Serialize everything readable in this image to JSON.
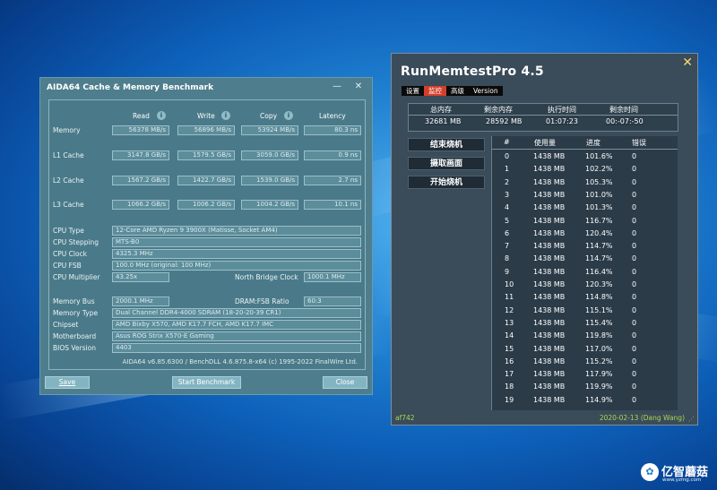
{
  "aida": {
    "title": "AIDA64 Cache & Memory Benchmark",
    "minimize": "—",
    "close": "✕",
    "columns": {
      "read": "Read",
      "write": "Write",
      "copy": "Copy",
      "latency": "Latency"
    },
    "info_glyph": "i",
    "bench_rows": [
      {
        "label": "Memory",
        "read": "56378 MB/s",
        "write": "56896 MB/s",
        "copy": "53924 MB/s",
        "latency": "80.3 ns"
      },
      {
        "label": "L1 Cache",
        "read": "3147.8 GB/s",
        "write": "1579.5 GB/s",
        "copy": "3059.0 GB/s",
        "latency": "0.9 ns"
      },
      {
        "label": "L2 Cache",
        "read": "1567.2 GB/s",
        "write": "1422.7 GB/s",
        "copy": "1539.0 GB/s",
        "latency": "2.7 ns"
      },
      {
        "label": "L3 Cache",
        "read": "1066.2 GB/s",
        "write": "1006.2 GB/s",
        "copy": "1004.2 GB/s",
        "latency": "10.1 ns"
      }
    ],
    "cpu": {
      "type_label": "CPU Type",
      "type": "12-Core AMD Ryzen 9 3900X  (Matisse, Socket AM4)",
      "stepping_label": "CPU Stepping",
      "stepping": "MTS-B0",
      "clock_label": "CPU Clock",
      "clock": "4325.3 MHz",
      "fsb_label": "CPU FSB",
      "fsb": "100.0 MHz  (original: 100 MHz)",
      "multiplier_label": "CPU Multiplier",
      "multiplier": "43.25x",
      "nb_label": "North Bridge Clock",
      "nb": "1000.1 MHz"
    },
    "mem": {
      "bus_label": "Memory Bus",
      "bus": "2000.1 MHz",
      "ratio_label": "DRAM:FSB Ratio",
      "ratio": "60:3",
      "type_label": "Memory Type",
      "type": "Dual Channel DDR4-4000 SDRAM  (18-20-20-39 CR1)",
      "chipset_label": "Chipset",
      "chipset": "AMD Bixby X570, AMD K17.7 FCH, AMD K17.7 IMC",
      "mobo_label": "Motherboard",
      "mobo": "Asus ROG Strix X570-E Gaming",
      "bios_label": "BIOS Version",
      "bios": "4403"
    },
    "footer": "AIDA64 v6.85.6300 / BenchDLL 4.6.875.8-x64  (c) 1995-2022 FinalWire Ltd.",
    "buttons": {
      "save": "Save",
      "start": "Start Benchmark",
      "close": "Close"
    }
  },
  "rmt": {
    "title": "RunMemtestPro 4.5",
    "close": "✕",
    "menu": [
      "设置",
      "监控",
      "高级",
      "Version"
    ],
    "active_menu": "监控",
    "summary_headers": [
      "总内存",
      "剩余内存",
      "执行时间",
      "剩余时间"
    ],
    "summary_values": [
      "32681 MB",
      "28592 MB",
      "01:07:23",
      "00:-07:-50"
    ],
    "side_buttons": [
      "结束烧机",
      "摄取画面",
      "开始烧机"
    ],
    "table_headers": [
      "#",
      "使用量",
      "进度",
      "错误"
    ],
    "rows": [
      [
        "0",
        "1438 MB",
        "101.6%",
        "0"
      ],
      [
        "1",
        "1438 MB",
        "102.2%",
        "0"
      ],
      [
        "2",
        "1438 MB",
        "105.3%",
        "0"
      ],
      [
        "3",
        "1438 MB",
        "101.0%",
        "0"
      ],
      [
        "4",
        "1438 MB",
        "101.3%",
        "0"
      ],
      [
        "5",
        "1438 MB",
        "116.7%",
        "0"
      ],
      [
        "6",
        "1438 MB",
        "120.4%",
        "0"
      ],
      [
        "7",
        "1438 MB",
        "114.7%",
        "0"
      ],
      [
        "8",
        "1438 MB",
        "114.7%",
        "0"
      ],
      [
        "9",
        "1438 MB",
        "116.4%",
        "0"
      ],
      [
        "10",
        "1438 MB",
        "120.3%",
        "0"
      ],
      [
        "11",
        "1438 MB",
        "114.8%",
        "0"
      ],
      [
        "12",
        "1438 MB",
        "115.1%",
        "0"
      ],
      [
        "13",
        "1438 MB",
        "115.4%",
        "0"
      ],
      [
        "14",
        "1438 MB",
        "119.8%",
        "0"
      ],
      [
        "15",
        "1438 MB",
        "117.0%",
        "0"
      ],
      [
        "16",
        "1438 MB",
        "115.2%",
        "0"
      ],
      [
        "17",
        "1438 MB",
        "117.9%",
        "0"
      ],
      [
        "18",
        "1438 MB",
        "119.9%",
        "0"
      ],
      [
        "19",
        "1438 MB",
        "114.9%",
        "0"
      ]
    ],
    "status_left": "af742",
    "status_right": "2020-02-13 (Dang Wang)"
  },
  "watermark": {
    "name": "亿智蘑菇",
    "url": "www.yzmg.com",
    "logo_glyph": "✿"
  }
}
